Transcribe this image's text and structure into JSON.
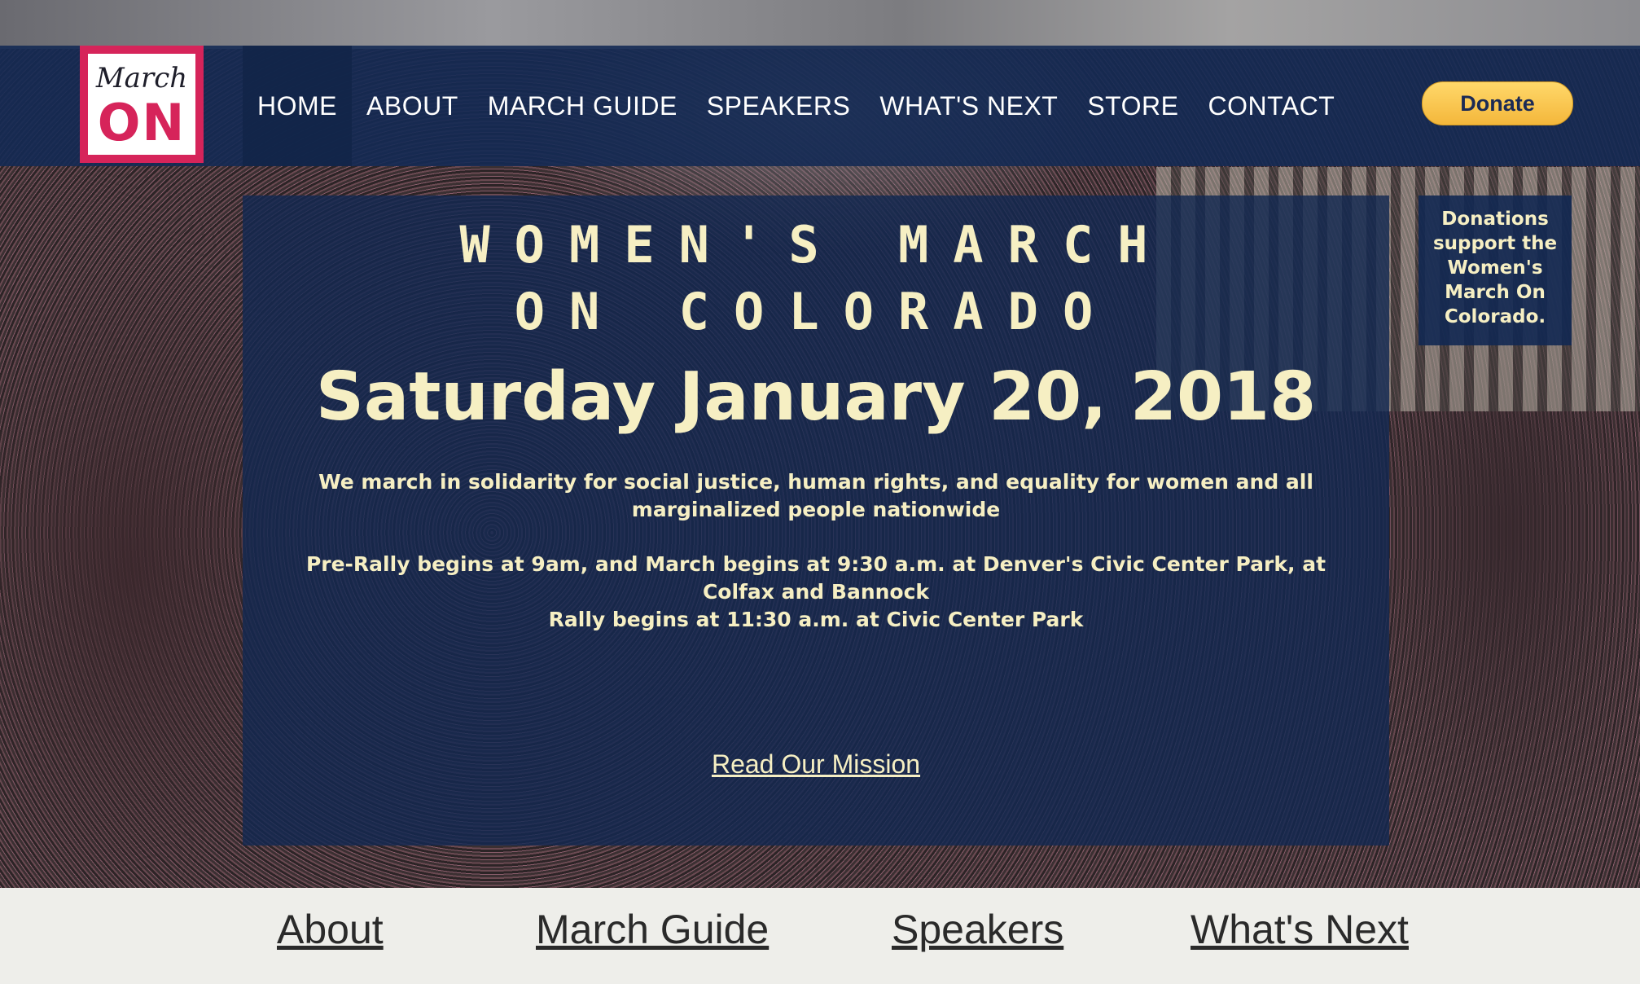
{
  "logo": {
    "top_text": "March",
    "bottom_text": "ON"
  },
  "nav": {
    "items": [
      {
        "label": "HOME",
        "active": true
      },
      {
        "label": "ABOUT"
      },
      {
        "label": "MARCH GUIDE"
      },
      {
        "label": "SPEAKERS"
      },
      {
        "label": "WHAT'S NEXT"
      },
      {
        "label": "STORE"
      },
      {
        "label": "CONTACT"
      }
    ],
    "donate_label": "Donate"
  },
  "hero": {
    "title_line1": "WOMEN'S MARCH",
    "title_line2": "ON COLORADO",
    "date": "Saturday January 20, 2018",
    "mission_line1": "We march in solidarity for social justice, human rights, and equality for women and all",
    "mission_line2": "marginalized people nationwide",
    "schedule_line1": "Pre-Rally begins at 9am, and March begins at 9:30 a.m. at Denver's Civic Center Park, at",
    "schedule_line2": "Colfax and Bannock",
    "schedule_line3": "Rally begins at 11:30 a.m. at Civic Center Park",
    "mission_link": "Read Our Mission"
  },
  "side_note": {
    "line1": "Donations",
    "line2": "support the",
    "line3": "Women's",
    "line4": "March On",
    "line5": "Colorado."
  },
  "footer": {
    "links": [
      "About",
      "March Guide",
      "Speakers",
      "What's Next"
    ]
  },
  "colors": {
    "nav_bg": "#142a54",
    "logo_accent": "#d6245a",
    "cream_text": "#f6efc3",
    "donate_yellow": "#f4b73b",
    "footer_bg": "#eeeeea"
  }
}
